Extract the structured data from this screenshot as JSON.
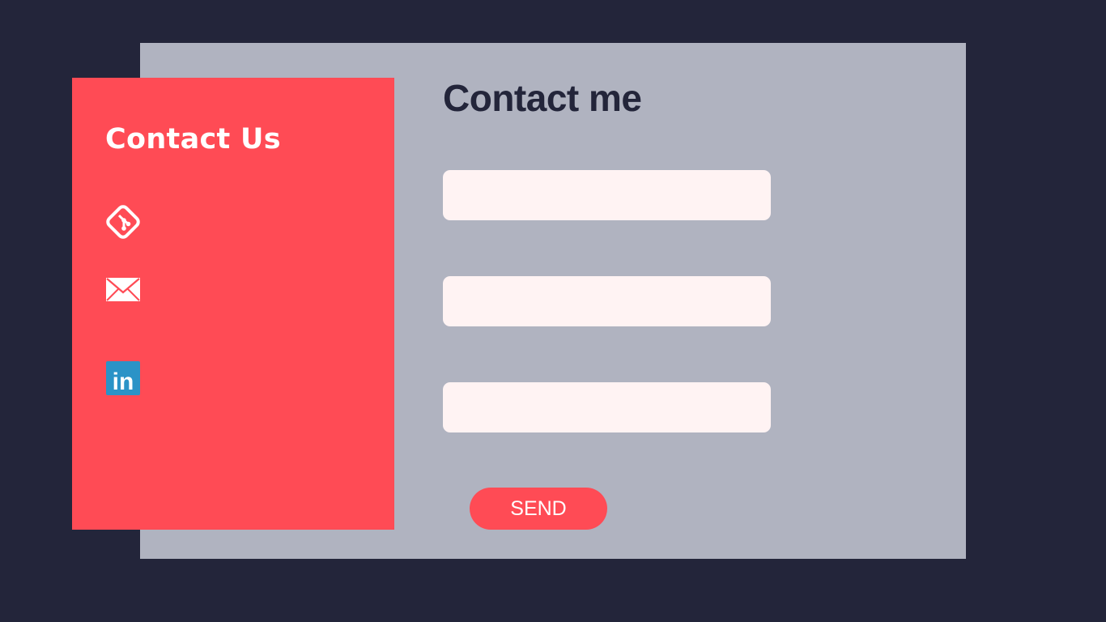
{
  "contact_card": {
    "title": "Contact Us",
    "links": [
      {
        "icon": "git-icon"
      },
      {
        "icon": "mail-icon"
      },
      {
        "icon": "linkedin-icon",
        "linkedin_text": "in"
      }
    ]
  },
  "form": {
    "title": "Contact me",
    "fields": [
      {
        "value": "",
        "placeholder": ""
      },
      {
        "value": "",
        "placeholder": ""
      },
      {
        "value": "",
        "placeholder": ""
      }
    ],
    "send_label": "SEND"
  },
  "colors": {
    "background": "#23253a",
    "panel": "#b0b3c0",
    "accent": "#ff4b55",
    "field": "#fff3f3",
    "linkedin": "#2b93c7"
  }
}
